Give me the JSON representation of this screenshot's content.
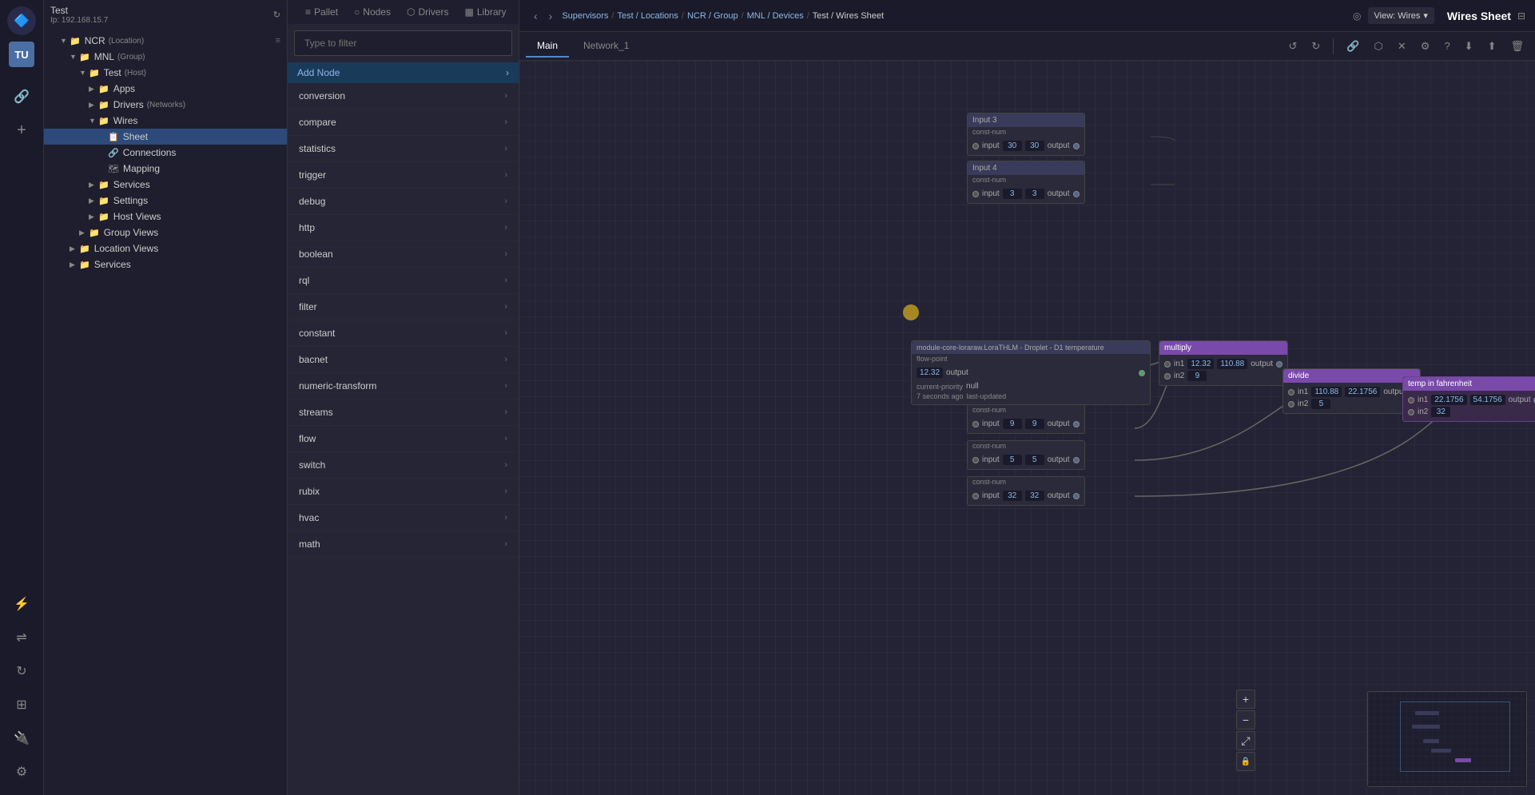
{
  "app": {
    "logo_text": "🔷",
    "avatar": "TU",
    "ip": "Ip: 192.168.15.7"
  },
  "sidebar_icons": [
    {
      "name": "link-icon",
      "symbol": "🔗",
      "active": true
    },
    {
      "name": "add-icon",
      "symbol": "+"
    },
    {
      "name": "flash-icon",
      "symbol": "⚡",
      "bottom": true
    },
    {
      "name": "share-icon",
      "symbol": "⇌",
      "bottom": true
    },
    {
      "name": "refresh-icon",
      "symbol": "↻",
      "bottom": true
    },
    {
      "name": "grid-icon",
      "symbol": "⊞",
      "bottom": true
    },
    {
      "name": "plug-icon",
      "symbol": "⚙",
      "bottom": true
    },
    {
      "name": "settings-icon",
      "symbol": "⚙",
      "bottom": true
    }
  ],
  "tree": {
    "header_title": "Test",
    "header_ip": "Ip: 192.168.15.7",
    "items": [
      {
        "id": "ncr",
        "label": "NCR",
        "badge": "(Location)",
        "indent": 1,
        "arrow": "▼",
        "icon": "📁",
        "has_action": true
      },
      {
        "id": "mnl",
        "label": "MNL",
        "badge": "(Group)",
        "indent": 2,
        "arrow": "▼",
        "icon": "📁"
      },
      {
        "id": "test",
        "label": "Test",
        "badge": "(Host)",
        "indent": 3,
        "arrow": "▼",
        "icon": "📁"
      },
      {
        "id": "apps",
        "label": "Apps",
        "indent": 4,
        "arrow": "▶",
        "icon": "📁"
      },
      {
        "id": "drivers",
        "label": "Drivers",
        "badge": "(Networks)",
        "indent": 4,
        "arrow": "▶",
        "icon": "📁"
      },
      {
        "id": "wires",
        "label": "Wires",
        "indent": 4,
        "arrow": "▼",
        "icon": "📁"
      },
      {
        "id": "sheet",
        "label": "Sheet",
        "indent": 5,
        "arrow": "",
        "icon": "📋",
        "selected": true
      },
      {
        "id": "connections",
        "label": "Connections",
        "indent": 5,
        "arrow": "",
        "icon": "🔗"
      },
      {
        "id": "mapping",
        "label": "Mapping",
        "indent": 5,
        "arrow": "",
        "icon": "🗺"
      },
      {
        "id": "services-sub",
        "label": "Services",
        "indent": 4,
        "arrow": "▶",
        "icon": "📁"
      },
      {
        "id": "settings",
        "label": "Settings",
        "indent": 4,
        "arrow": "▶",
        "icon": "📁"
      },
      {
        "id": "host-views",
        "label": "Host Views",
        "indent": 4,
        "arrow": "▶",
        "icon": "📁"
      },
      {
        "id": "group-views",
        "label": "Group Views",
        "indent": 3,
        "arrow": "▶",
        "icon": "📁"
      },
      {
        "id": "location-views",
        "label": "Location Views",
        "indent": 2,
        "arrow": "▶",
        "icon": "📁"
      },
      {
        "id": "services",
        "label": "Services",
        "indent": 2,
        "arrow": "▶",
        "icon": "📁"
      }
    ]
  },
  "filter": {
    "placeholder": "Type to filter"
  },
  "nodes_toolbar": {
    "tabs": [
      {
        "label": "Pallet",
        "icon": "≡"
      },
      {
        "label": "Nodes",
        "icon": "○"
      },
      {
        "label": "Drivers",
        "icon": "⬡"
      },
      {
        "label": "Library",
        "icon": "▦"
      }
    ],
    "undo_label": "↺",
    "redo_label": "↻"
  },
  "add_node": {
    "header": "Add Node",
    "items": [
      {
        "label": "conversion"
      },
      {
        "label": "compare"
      },
      {
        "label": "statistics"
      },
      {
        "label": "trigger"
      },
      {
        "label": "debug"
      },
      {
        "label": "http"
      },
      {
        "label": "boolean"
      },
      {
        "label": "rql"
      },
      {
        "label": "filter"
      },
      {
        "label": "constant"
      },
      {
        "label": "bacnet"
      },
      {
        "label": "numeric-transform"
      },
      {
        "label": "streams"
      },
      {
        "label": "flow"
      },
      {
        "label": "switch"
      },
      {
        "label": "rubix"
      },
      {
        "label": "hvac"
      },
      {
        "label": "math"
      }
    ]
  },
  "breadcrumb": {
    "items": [
      "Supervisors",
      "Test / Locations",
      "NCR / Group",
      "MNL / Devices",
      "Test / Wires Sheet"
    ]
  },
  "top_bar": {
    "view_label": "View: Wires",
    "title": "Wires Sheet"
  },
  "tabs": [
    {
      "label": "Main",
      "active": true
    },
    {
      "label": "Network_1",
      "active": false
    }
  ],
  "toolbar_icons": [
    "🔗",
    "⬡",
    "✕",
    "⚙",
    "?",
    "⬇",
    "⬆",
    "🗑"
  ],
  "nodes": {
    "input3": {
      "title": "Input 3",
      "subtitle": "const-num",
      "input_val": "30",
      "output_val": "30"
    },
    "input4": {
      "title": "Input 4",
      "subtitle": "const-num",
      "input_val": "3",
      "output_val": "3"
    },
    "main_node": {
      "title": "module-core-loraraw.LoraTHLM - Droplet - D1 temperature",
      "subtitle": "flow-point",
      "val1": "12.32",
      "label_cp": "current-priority",
      "val_cp": "null",
      "label_ts": "7 seconds ago",
      "label_lu": "last-updated"
    },
    "multiply": {
      "title": "multiply",
      "in1_val": "12.32",
      "in2_val": "9",
      "output_val": "110.88"
    },
    "divide": {
      "title": "divide",
      "in1_val": "110.88",
      "in2_val": "5",
      "output_val": "22.1756"
    },
    "temp": {
      "title": "temp in fahrenheit",
      "in1_val": "22.1756",
      "in2_val": "32",
      "output_val": "54.1756"
    },
    "const9": {
      "subtitle": "const-num",
      "input_val": "9",
      "output_val": "9"
    },
    "const5": {
      "subtitle": "const-num",
      "input_val": "5",
      "output_val": "5"
    },
    "const32": {
      "subtitle": "const-num",
      "input_val": "32",
      "output_val": "32"
    }
  },
  "zoom": {
    "plus": "+",
    "minus": "−",
    "fit": "⤢",
    "lock": "🔒"
  }
}
